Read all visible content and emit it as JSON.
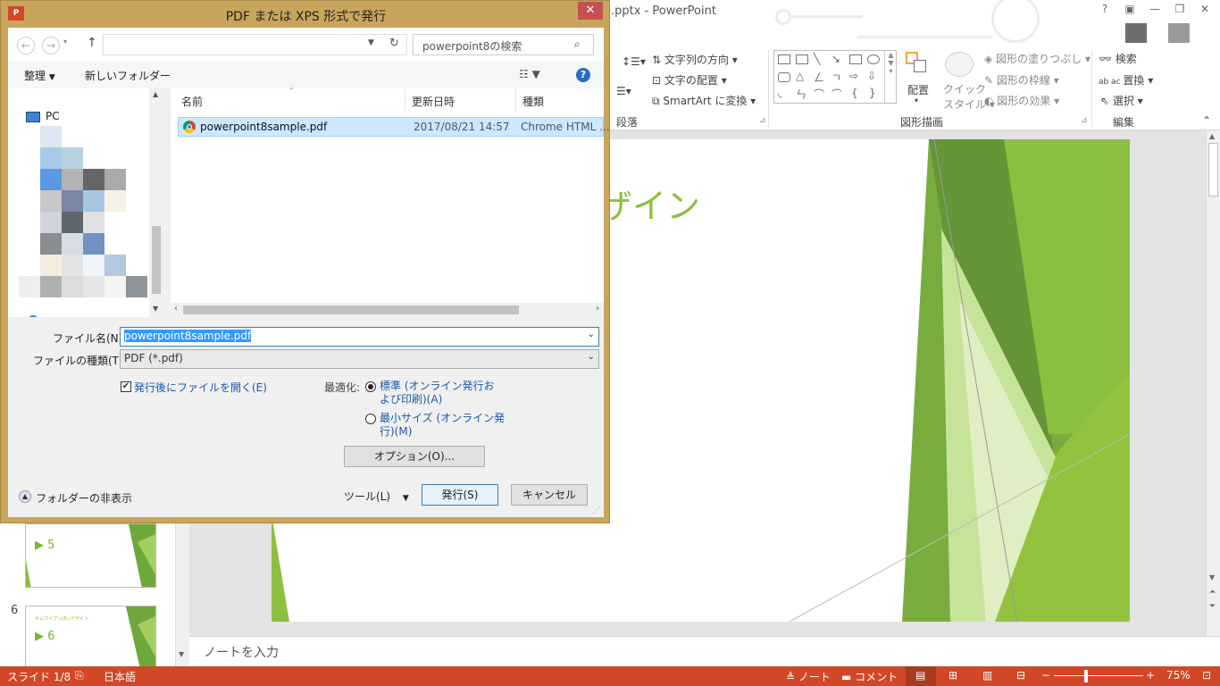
{
  "powerpoint": {
    "title": "...pptx - PowerPoint",
    "title_visible": "e.pptx - PowerPoint",
    "ribbon": {
      "text_direction": "文字列の方向",
      "text_align": "文字の配置",
      "smartart": "SmartArt に変換",
      "paragraph_group": "段落",
      "arrange": "配置",
      "quick_style": "クイック\nスタイル",
      "quick_style_line1": "クイック",
      "quick_style_line2": "スタイル",
      "shape_fill": "図形の塗りつぶし",
      "shape_outline": "図形の枠線",
      "shape_effects": "図形の効果",
      "drawing_group": "図形描画",
      "find": "検索",
      "replace": "置換",
      "select": "選択",
      "editing_group": "編集"
    },
    "slide_title": "デザイン",
    "slide_title_visible": "ザイン",
    "thumbnails": [
      {
        "number": "",
        "label": "5"
      },
      {
        "number": "6",
        "label": "6",
        "small_title": "キムワイプっぽいデザイン"
      }
    ],
    "notes_placeholder": "ノートを入力",
    "status": {
      "slide": "スライド 1/8",
      "language": "日本語",
      "notes": "ノート",
      "comments": "コメント",
      "zoom": "75%"
    },
    "accent_color": "#d24726",
    "slide_green": "#8bbf3f"
  },
  "dialog": {
    "title": "PDF または XPS 形式で発行",
    "close": "✕",
    "search_placeholder": "powerpoint8の検索",
    "toolbar": {
      "organize": "整理",
      "new_folder": "新しいフォルダー"
    },
    "nav": {
      "pc": "PC"
    },
    "columns": {
      "name": "名前",
      "date": "更新日時",
      "type": "種類"
    },
    "files": [
      {
        "name": "powerpoint8sample.pdf",
        "date": "2017/08/21 14:57",
        "type": "Chrome HTML ..."
      }
    ],
    "filename_label": "ファイル名(N):",
    "filename_value": "powerpoint8sample.pdf",
    "filetype_label": "ファイルの種類(T):",
    "filetype_value": "PDF (*.pdf)",
    "open_after": "発行後にファイルを開く(E)",
    "optimize_label": "最適化:",
    "opt_standard_1": "標準 (オンライン発行お",
    "opt_standard_2": "よび印刷)(A)",
    "opt_min_1": "最小サイズ (オンライン発",
    "opt_min_2": "行)(M)",
    "options_button": "オプション(O)...",
    "hide_folders": "フォルダーの非表示",
    "tools": "ツール(L)",
    "publish": "発行(S)",
    "cancel": "キャンセル"
  }
}
